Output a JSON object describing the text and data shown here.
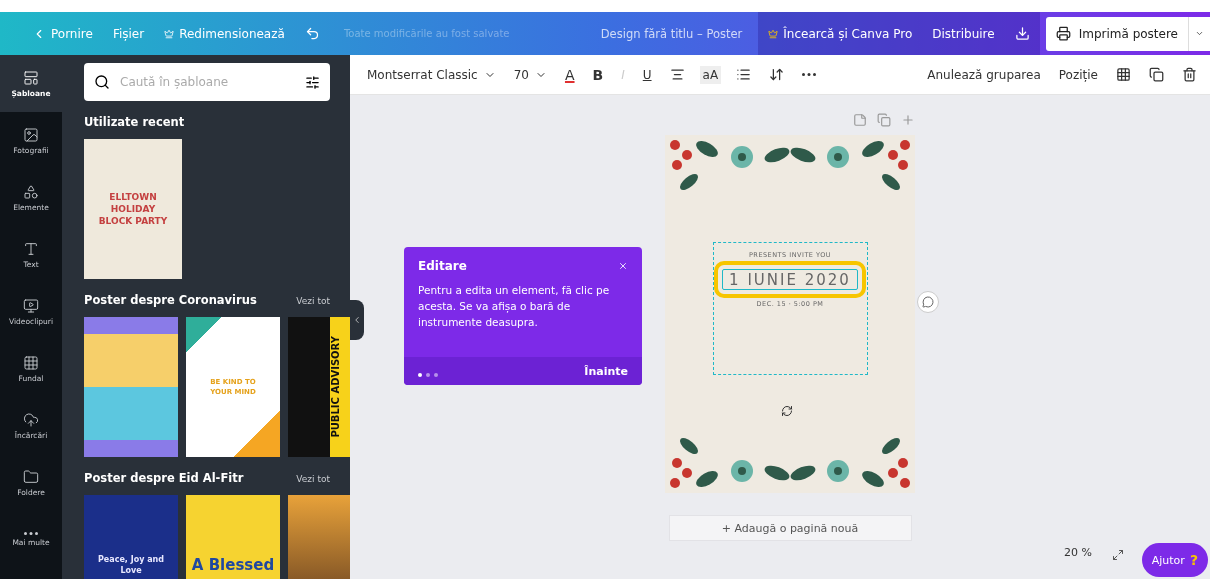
{
  "topbar": {
    "back": "Pornire",
    "file": "Fișier",
    "resize": "Redimensionează",
    "status": "Toate modificările au fost salvate",
    "title": "Design fără titlu – Poster",
    "pro": "Încearcă și Canva Pro",
    "share": "Distribuire",
    "print": "Imprimă postere"
  },
  "rail": [
    {
      "kind": "templates",
      "label": "Șabloane",
      "selected": true
    },
    {
      "kind": "photos",
      "label": "Fotografii",
      "selected": false
    },
    {
      "kind": "elements",
      "label": "Elemente",
      "selected": false
    },
    {
      "kind": "text",
      "label": "Text",
      "selected": false
    },
    {
      "kind": "videos",
      "label": "Videoclipuri",
      "selected": false
    },
    {
      "kind": "background",
      "label": "Fundal",
      "selected": false
    },
    {
      "kind": "uploads",
      "label": "Încărcări",
      "selected": false
    },
    {
      "kind": "folders",
      "label": "Foldere",
      "selected": false
    },
    {
      "kind": "more",
      "label": "Mai multe",
      "selected": false
    }
  ],
  "search": {
    "placeholder": "Caută în șabloane"
  },
  "sections": [
    {
      "title": "Utilizate recent",
      "templates": [
        {
          "kind": "holiday",
          "texts": [
            "ELLTOWN",
            "HOLIDAY",
            "BLOCK PARTY"
          ]
        }
      ]
    },
    {
      "title": "Poster despre Coronavirus",
      "see_all": "Vezi tot",
      "templates": [
        {
          "kind": "infographic"
        },
        {
          "kind": "rainbow",
          "texts": [
            "BE KIND TO",
            "YOUR MIND"
          ]
        },
        {
          "kind": "advisory",
          "texts": [
            "PUBLIC ADVISORY"
          ]
        }
      ]
    },
    {
      "title": "Poster despre Eid Al-Fitr",
      "see_all": "Vezi tot",
      "templates": [
        {
          "kind": "night",
          "texts": [
            "Peace, Joy and",
            "Love"
          ]
        },
        {
          "kind": "blessed",
          "texts": [
            "A Blessed"
          ]
        },
        {
          "kind": "sunset"
        }
      ]
    }
  ],
  "toolbar": {
    "font": "Montserrat Classic",
    "size": "70",
    "format": [
      {
        "kind": "color",
        "label": "A",
        "disabled": false
      },
      {
        "kind": "bold",
        "label": "B",
        "disabled": false
      },
      {
        "kind": "italic",
        "label": "I",
        "disabled": true
      },
      {
        "kind": "underline",
        "label": "U",
        "disabled": false
      },
      {
        "kind": "align",
        "disabled": false
      },
      {
        "kind": "case",
        "label": "aA",
        "disabled": false
      },
      {
        "kind": "list",
        "disabled": false
      },
      {
        "kind": "spacing",
        "disabled": false
      },
      {
        "kind": "more",
        "disabled": false
      }
    ],
    "ungroup": "Anulează gruparea",
    "position": "Poziție"
  },
  "tooltip": {
    "title": "Editare",
    "body": "Pentru a edita un element, fă clic pe acesta. Se va afișa o bară de instrumente deasupra.",
    "steps": [
      {
        "selected": true
      },
      {
        "selected": false
      },
      {
        "selected": false
      }
    ],
    "next": "Înainte"
  },
  "poster": {
    "subtitle": "PRESENTS INVITE YOU",
    "date": "1 IUNIE 2020",
    "when": "DEC. 15 · 5:00 PM"
  },
  "add_page": "+ Adaugă o pagină nouă",
  "zoom": "20 %",
  "help": {
    "label": "Ajutor",
    "mark": "?"
  }
}
